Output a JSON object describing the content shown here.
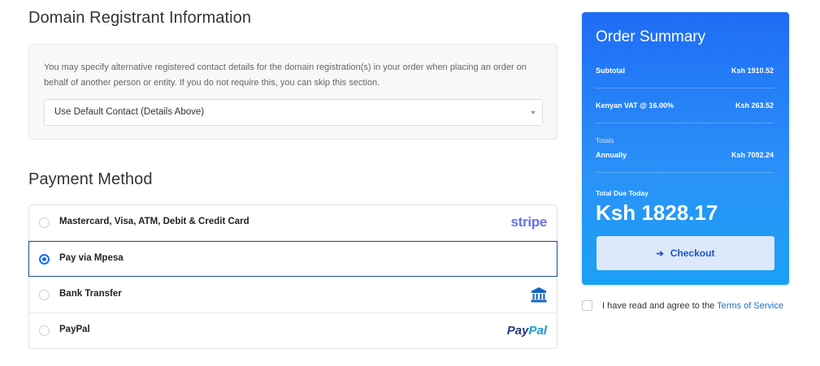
{
  "domain_section": {
    "title": "Domain Registrant Information",
    "info": "You may specify alternative registered contact details for the domain registration(s) in your order when placing an order on behalf of another person or entity. If you do not require this, you can skip this section.",
    "contact_select": "Use Default Contact (Details Above)"
  },
  "payment_section": {
    "title": "Payment Method",
    "methods": [
      {
        "label": "Mastercard, Visa, ATM, Debit & Credit Card",
        "selected": false,
        "logo": "stripe"
      },
      {
        "label": "Pay via Mpesa",
        "selected": true,
        "logo": ""
      },
      {
        "label": "Bank Transfer",
        "selected": false,
        "logo": "bank-icon"
      },
      {
        "label": "PayPal",
        "selected": false,
        "logo": "paypal"
      }
    ],
    "stripe_logo_text": "stripe",
    "paypal_logo_text_1": "Pay",
    "paypal_logo_text_2": "Pal"
  },
  "summary": {
    "title": "Order Summary",
    "subtotal_label": "Subtotal",
    "subtotal_value": "Ksh 1910.52",
    "vat_label": "Kenyan VAT @ 16.00%",
    "vat_value": "Ksh 263.52",
    "totals_label": "Totals",
    "annually_label": "Annually",
    "annually_value": "Ksh 7092.24",
    "due_label": "Total Due Today",
    "due_value": "Ksh 1828.17",
    "checkout_label": "Checkout"
  },
  "tos": {
    "text": "I have read and agree to the ",
    "link": "Terms of Service"
  },
  "colors": {
    "accent": "#1f6cf5",
    "link": "#1c6fc7",
    "stripe": "#6772e5",
    "paypal_dark": "#253b80",
    "paypal_light": "#179bd7"
  }
}
